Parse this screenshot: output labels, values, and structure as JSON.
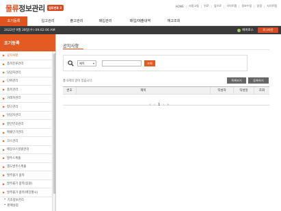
{
  "header": {
    "logo_red": "물류",
    "logo_dark": "정보관리",
    "badge": "업무번호 3",
    "topnav": [
      "HOME",
      "사용고침",
      "뒤로",
      "앞으로",
      "사이트맵",
      "정보수정",
      "일정",
      "사이트맵"
    ]
  },
  "menu": {
    "items": [
      "초기등록",
      "입고관리",
      "출고관리",
      "매입관리",
      "매입/매출내역",
      "재고조회"
    ],
    "active_index": 0
  },
  "status": {
    "datetime": "2022년 9월 28일(수) 09:02:06 AM",
    "user": "에버로스",
    "logout": "로그아웃"
  },
  "sidebar": {
    "title": "초기등록",
    "items": [
      "공지사항",
      "품목분류관리",
      "담당자관리",
      "단위관리",
      "품목관리",
      "거래처관리",
      "창고관리",
      "담당자관리",
      "할인반호관리",
      "매출단가관리",
      "코스관리",
      "매장코스일괄관리",
      "발주스케줄",
      "별도발주스케줄",
      "발주불가 품목",
      "발주불가 품목(일괄)",
      "발주불가 품목(매장별시)"
    ],
    "active_index": 0,
    "sub_groups": [
      "기초정보관리",
      "판매설정"
    ]
  },
  "main": {
    "title": "공지사항",
    "search": {
      "select_value": "제목",
      "input_value": "",
      "button": "조회"
    },
    "count_text": "총 0개의 글이 있습니다.",
    "buttons": {
      "reload": "목록보기",
      "register": "등록하기"
    },
    "grid_columns": [
      "번호",
      "제목",
      "작성자",
      "작성일",
      "조회"
    ],
    "pager": {
      "first": "«",
      "prev": "‹",
      "page": "1",
      "next": "›",
      "last": "»"
    }
  },
  "colors": {
    "accent": "#e35a22",
    "status_bg": "#3a3a3a"
  }
}
